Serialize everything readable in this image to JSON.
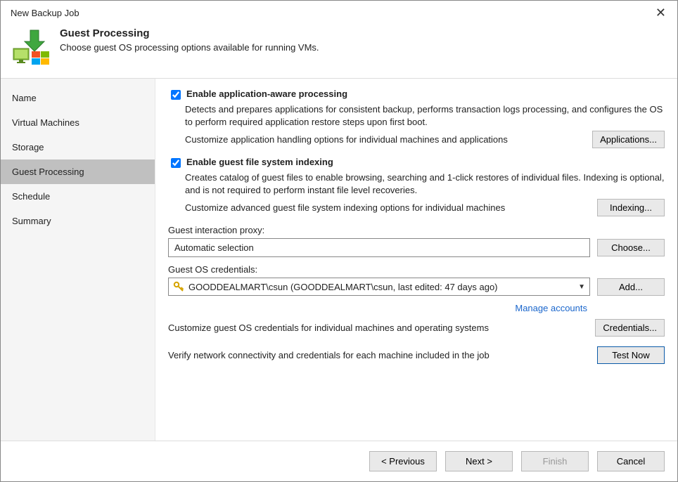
{
  "window": {
    "title": "New Backup Job"
  },
  "header": {
    "title": "Guest Processing",
    "subtitle": "Choose guest OS processing options available for running VMs."
  },
  "sidebar": {
    "items": [
      {
        "label": "Name"
      },
      {
        "label": "Virtual Machines"
      },
      {
        "label": "Storage"
      },
      {
        "label": "Guest Processing",
        "selected": true
      },
      {
        "label": "Schedule"
      },
      {
        "label": "Summary"
      }
    ]
  },
  "content": {
    "appAware": {
      "label": "Enable application-aware processing",
      "desc": "Detects and prepares applications for consistent backup, performs transaction logs processing, and configures the OS to perform required application restore steps upon first boot.",
      "customize": "Customize application handling options for individual machines and applications",
      "button": "Applications..."
    },
    "indexing": {
      "label": "Enable guest file system indexing",
      "desc": "Creates catalog of guest files to enable browsing, searching and 1-click restores of individual files. Indexing is optional, and is not required to perform instant file level recoveries.",
      "customize": "Customize advanced guest file system indexing options for individual machines",
      "button": "Indexing..."
    },
    "proxy": {
      "label": "Guest interaction proxy:",
      "value": "Automatic selection",
      "button": "Choose..."
    },
    "creds": {
      "label": "Guest OS credentials:",
      "value": "GOODDEALMART\\csun (GOODDEALMART\\csun, last edited: 47 days ago)",
      "button": "Add...",
      "manageLink": "Manage accounts",
      "customize": "Customize guest OS credentials for individual machines and operating systems",
      "customizeButton": "Credentials...",
      "verify": "Verify network connectivity and credentials for each machine included in the job",
      "verifyButton": "Test Now"
    }
  },
  "footer": {
    "previous": "< Previous",
    "next": "Next >",
    "finish": "Finish",
    "cancel": "Cancel"
  }
}
